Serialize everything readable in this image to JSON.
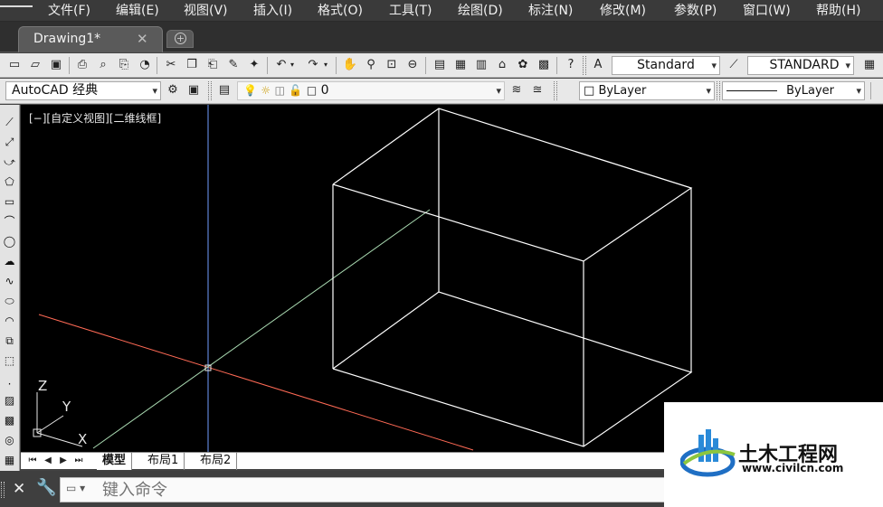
{
  "menu": [
    "文件(F)",
    "编辑(E)",
    "视图(V)",
    "插入(I)",
    "格式(O)",
    "工具(T)",
    "绘图(D)",
    "标注(N)",
    "修改(M)",
    "参数(P)",
    "窗口(W)",
    "帮助(H)"
  ],
  "document_tab": {
    "title": "Drawing1*",
    "close": "✕"
  },
  "toolbar1": {
    "text_style": "Standard",
    "dim_style": "STANDARD"
  },
  "toolbar2": {
    "workspace": "AutoCAD 经典",
    "layer": "0",
    "color": "ByLayer",
    "linetype": "ByLayer"
  },
  "viewport": {
    "label": "[−][自定义视图][二维线框]",
    "background": "#000000",
    "edge_color": "#ffffff",
    "x_axis_color": "#ff6a55",
    "y_axis_color": "#6f9cff",
    "ucs_labels": {
      "z": "Z",
      "y": "Y",
      "x": "X"
    }
  },
  "layout_tabs": [
    "模型",
    "布局1",
    "布局2"
  ],
  "command_line": {
    "placeholder": "键入命令"
  },
  "watermark": {
    "title": "土木工程网",
    "url": "www.civilcn.com"
  }
}
